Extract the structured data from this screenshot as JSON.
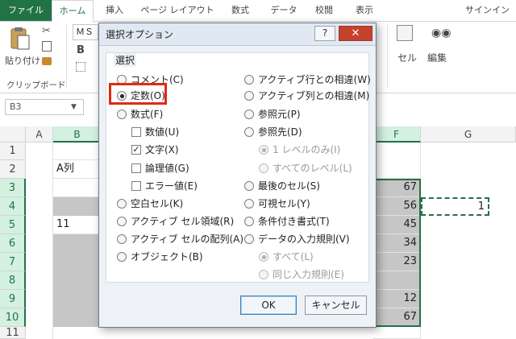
{
  "ribbon": {
    "tabs": [
      "ファイル",
      "ホーム",
      "挿入",
      "ページ レイアウト",
      "数式",
      "データ",
      "校閲",
      "表示"
    ],
    "signin": "サインイン",
    "paste_label": "貼り付け",
    "clipboard_label": "クリップボード",
    "font_name": "ＭＳ",
    "cells_label": "セル",
    "edit_label": "編集"
  },
  "formula_bar": {
    "namebox": "B3"
  },
  "sheet": {
    "columns": [
      "A",
      "B",
      "F",
      "G"
    ],
    "rows": [
      "1",
      "2",
      "3",
      "4",
      "5",
      "6",
      "7",
      "8",
      "9",
      "10",
      "11"
    ],
    "cells": {
      "B2": "A列",
      "B5": "11",
      "F3": "67",
      "F4": "56",
      "F5": "45",
      "F6": "34",
      "F7": "23",
      "F9": "12",
      "F10": "67",
      "G4": "1"
    }
  },
  "dialog": {
    "title": "選択オプション",
    "help": "?",
    "close": "✕",
    "group_title": "選択",
    "left_options": [
      "コメント(C)",
      "定数(O)",
      "数式(F)",
      "数値(U)",
      "文字(X)",
      "論理値(G)",
      "エラー値(E)",
      "空白セル(K)",
      "アクティブ セル領域(R)",
      "アクティブ セルの配列(A)",
      "オブジェクト(B)"
    ],
    "right_options": [
      "アクティブ行との相違(W)",
      "アクティブ列との相違(M)",
      "参照元(P)",
      "参照先(D)",
      "1 レベルのみ(I)",
      "すべてのレベル(L)",
      "最後のセル(S)",
      "可視セル(Y)",
      "条件付き書式(T)",
      "データの入力規則(V)",
      "すべて(L)",
      "同じ入力規則(E)"
    ],
    "selected_option": "定数(O)",
    "checked_options": [
      "文字(X)"
    ],
    "ok": "OK",
    "cancel": "キャンセル",
    "highlight_color": "#e02a14"
  },
  "colors": {
    "excel_green": "#217346",
    "selection_fill": "#c6c6c6"
  }
}
